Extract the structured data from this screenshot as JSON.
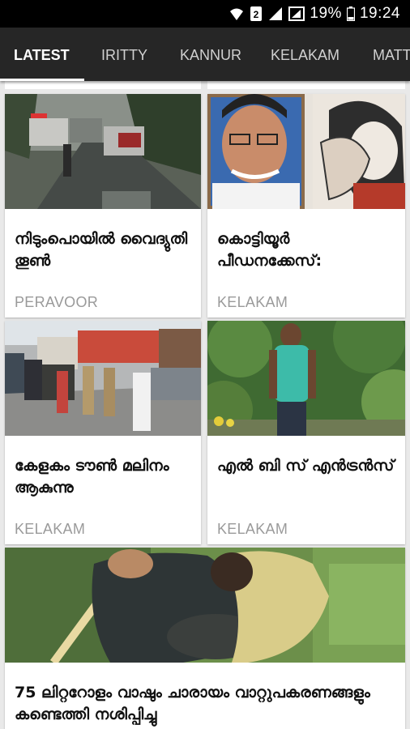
{
  "status_bar": {
    "battery_percent": "19%",
    "time": "19:24",
    "sim_badge": "2"
  },
  "tabs": [
    {
      "label": "LATEST",
      "active": true
    },
    {
      "label": "IRITTY",
      "active": false
    },
    {
      "label": "KANNUR",
      "active": false
    },
    {
      "label": "KELAKAM",
      "active": false
    },
    {
      "label": "MATT",
      "active": false
    }
  ],
  "articles": [
    {
      "title": "നിടുംപൊയിൽ വൈദ്യുതി തൂൺ",
      "category": "PERAVOOR",
      "image": "rainy-road-vehicles-photo"
    },
    {
      "title": "കൊട്ടിയൂർ പീഡനക്കേസ്:",
      "category": "KELAKAM",
      "image": "man-portrait-and-illustration-photo"
    },
    {
      "title": "കേളകം ടൗൺ മലിനം ആകുന്നു",
      "category": "KELAKAM",
      "image": "town-street-police-photo"
    },
    {
      "title": "എൽ ബി സ് എൻട്രൻസ്",
      "category": "KELAKAM",
      "image": "man-in-green-tshirt-photo"
    },
    {
      "title": "75 ലിറ്ററോളം വാഷും ചാരായം വാറ്റുപകരണങ്ങളും കണ്ടെത്തി നശിപ്പിച്ചു",
      "category": "",
      "image": "barrel-seizure-photo"
    }
  ],
  "colors": {
    "status_bar": "#000000",
    "tab_bar": "#262626",
    "background": "#e9e9e9",
    "card": "#ffffff",
    "category_text": "#9a9a9a"
  }
}
